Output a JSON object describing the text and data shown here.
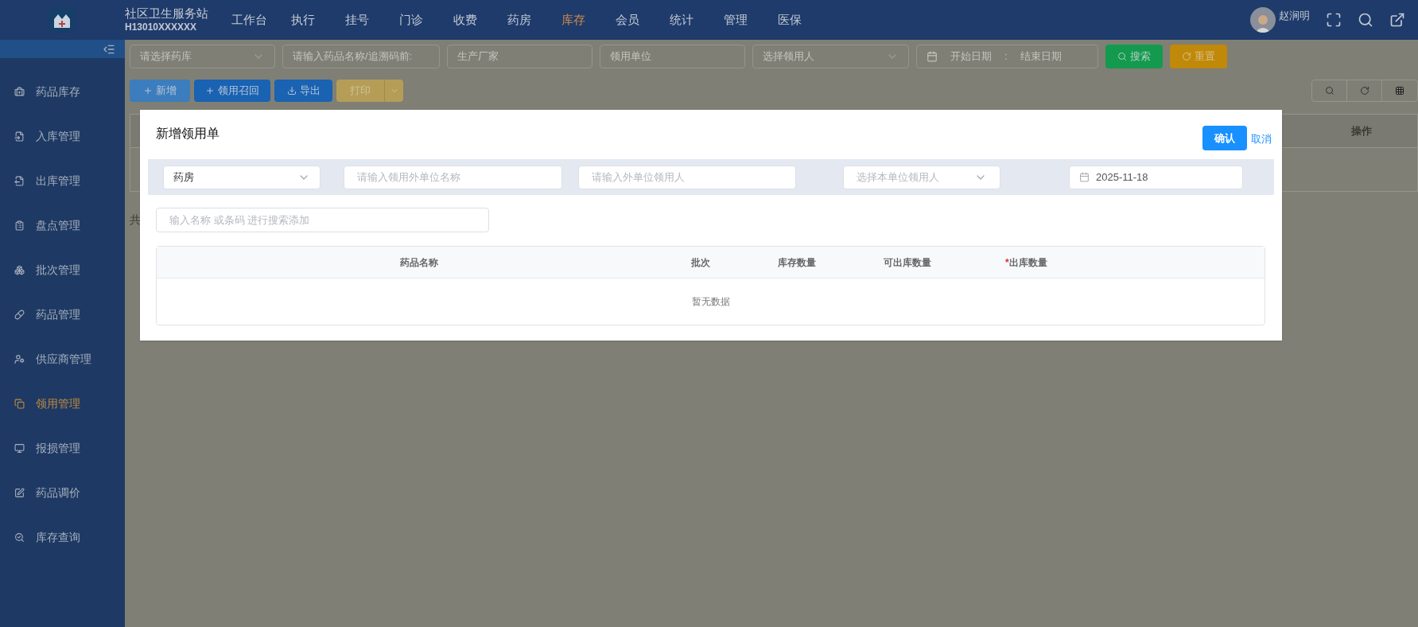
{
  "header": {
    "site_name": "社区卫生服务站",
    "site_code": "H13010XXXXXX",
    "user_name": "赵涧明"
  },
  "nav": [
    {
      "label": "工作台",
      "selected": false
    },
    {
      "label": "执行",
      "selected": false
    },
    {
      "label": "挂号",
      "selected": false
    },
    {
      "label": "门诊",
      "selected": false
    },
    {
      "label": "收费",
      "selected": false
    },
    {
      "label": "药房",
      "selected": false
    },
    {
      "label": "库存",
      "selected": true
    },
    {
      "label": "会员",
      "selected": false
    },
    {
      "label": "统计",
      "selected": false
    },
    {
      "label": "管理",
      "selected": false
    },
    {
      "label": "医保",
      "selected": false
    }
  ],
  "sidebar": {
    "items": [
      {
        "label": "药品库存",
        "selected": false
      },
      {
        "label": "入库管理",
        "selected": false
      },
      {
        "label": "出库管理",
        "selected": false
      },
      {
        "label": "盘点管理",
        "selected": false
      },
      {
        "label": "批次管理",
        "selected": false
      },
      {
        "label": "药品管理",
        "selected": false
      },
      {
        "label": "供应商管理",
        "selected": false
      },
      {
        "label": "领用管理",
        "selected": true
      },
      {
        "label": "报损管理",
        "selected": false
      },
      {
        "label": "药品调价",
        "selected": false
      },
      {
        "label": "库存查询",
        "selected": false
      }
    ]
  },
  "filters": {
    "warehouse": {
      "placeholder": "请选择药库"
    },
    "drug": {
      "placeholder": "请输入药品名称/追溯码前:"
    },
    "maker": {
      "placeholder": "生产厂家"
    },
    "unit": {
      "placeholder": "领用单位"
    },
    "recipient": {
      "placeholder": "选择领用人"
    },
    "start_date": {
      "placeholder": "开始日期"
    },
    "date_separator": ":",
    "end_date": {
      "placeholder": "结束日期"
    },
    "search_button": "搜索",
    "reset_button": "重置"
  },
  "actions": [
    {
      "kind": "add",
      "label": "新增"
    },
    {
      "kind": "recall",
      "label": "领用召回"
    },
    {
      "kind": "export",
      "label": "导出"
    },
    {
      "kind": "print",
      "label": "打印"
    }
  ],
  "background_table": {
    "column_last": "操作",
    "footer_fragment": "共"
  },
  "dialog": {
    "title": "新增领用单",
    "confirm_button": "确认",
    "cancel_link": "取消",
    "warehouse_select": {
      "value": "药房"
    },
    "outside_unit": {
      "placeholder": "请输入领用外单位名称"
    },
    "outside_person": {
      "placeholder": "请输入外单位领用人"
    },
    "inside_person": {
      "placeholder": "选择本单位领用人"
    },
    "date": {
      "value": "2025-11-18"
    },
    "search": {
      "placeholder": "输入名称 或条码 进行搜索添加"
    },
    "table": {
      "columns": [
        {
          "label": "药品名称",
          "required": false
        },
        {
          "label": "批次",
          "required": false
        },
        {
          "label": "库存数量",
          "required": false
        },
        {
          "label": "可出库数量",
          "required": false
        },
        {
          "label": "出库数量",
          "required": true
        }
      ],
      "required_mark": "*",
      "empty_text": "暂无数据"
    }
  }
}
